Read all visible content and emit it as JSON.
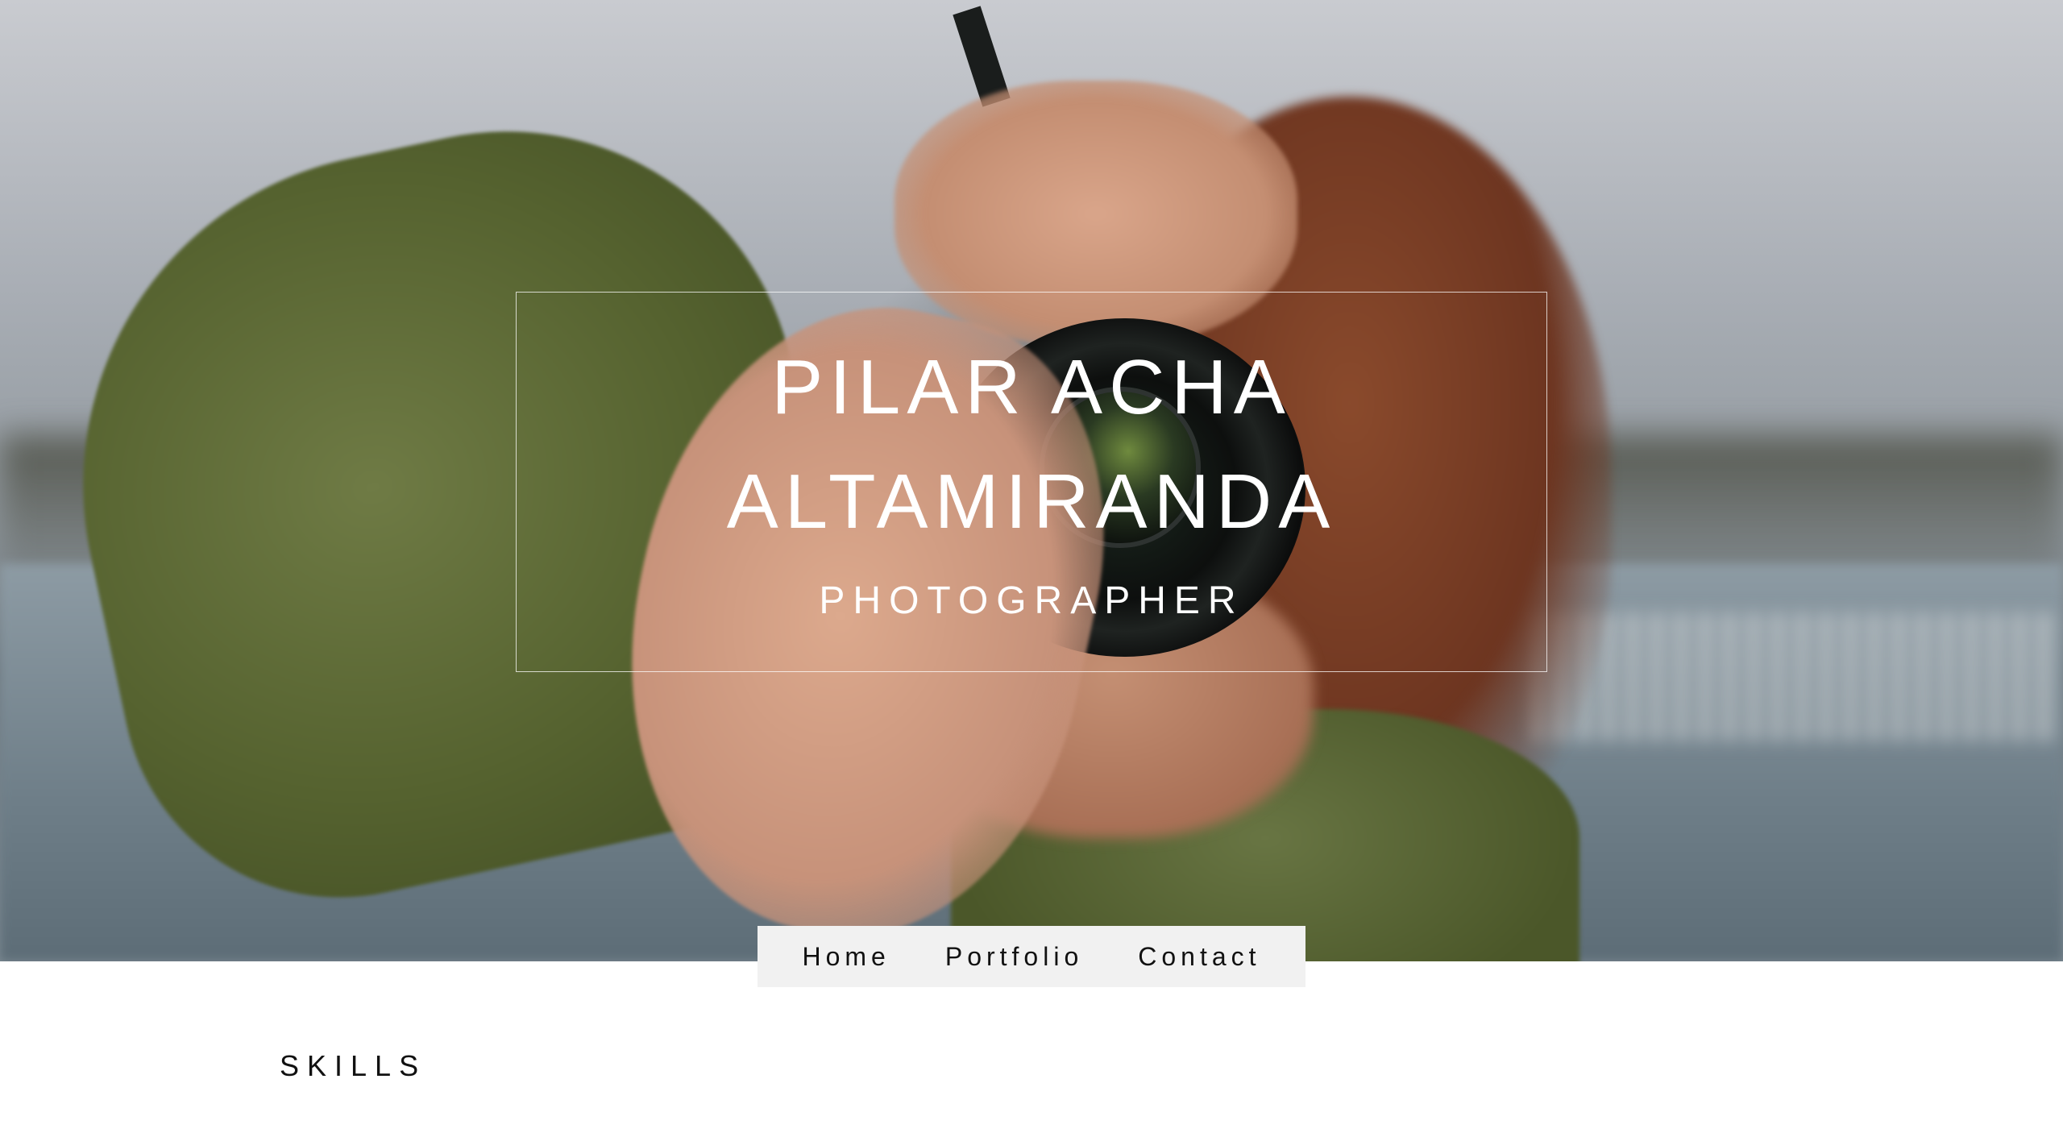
{
  "hero": {
    "name_line1": "PILAR ACHA",
    "name_line2": "ALTAMIRANDA",
    "subtitle": "PHOTOGRAPHER"
  },
  "nav": {
    "items": [
      {
        "label": "Home"
      },
      {
        "label": "Portfolio"
      },
      {
        "label": "Contact"
      }
    ]
  },
  "sections": {
    "skills_heading": "SKILLS"
  },
  "colors": {
    "nav_background": "#f1f1f1",
    "text_dark": "#111111",
    "hero_text": "#ffffff"
  }
}
